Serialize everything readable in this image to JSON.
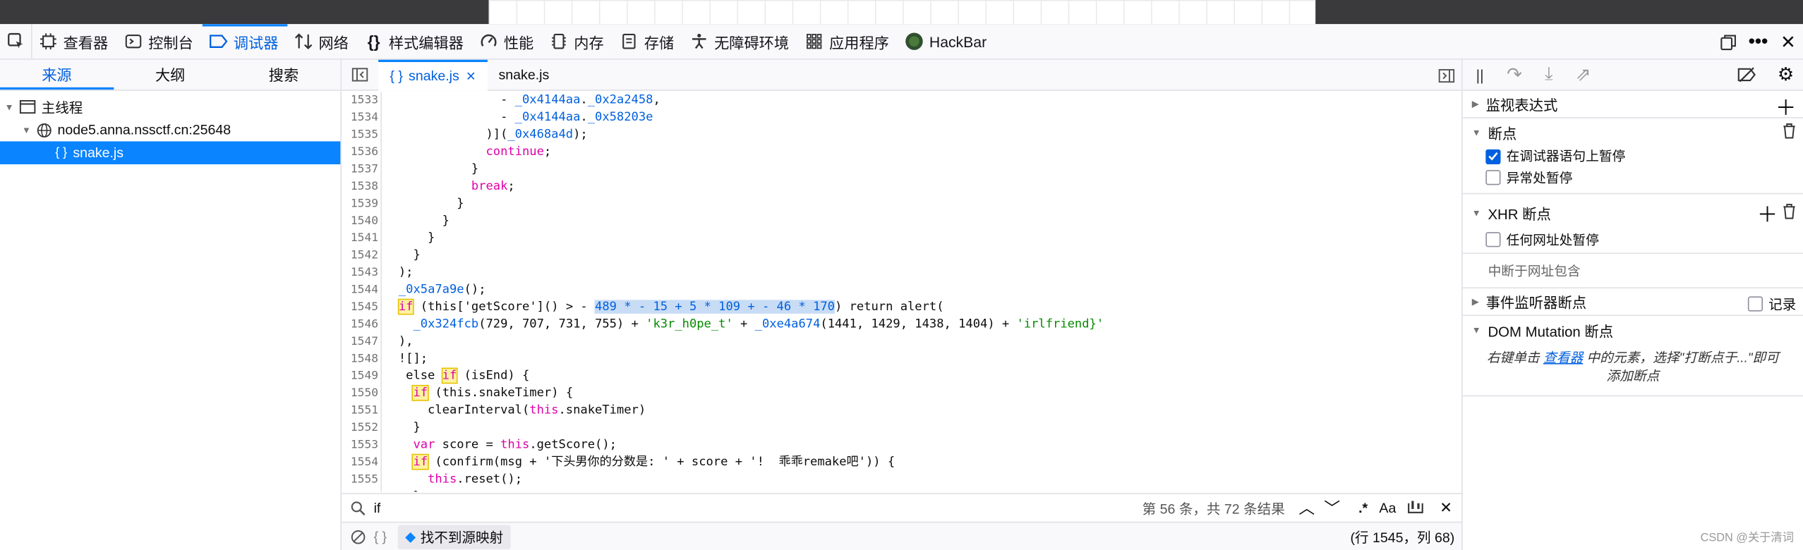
{
  "toolbar": {
    "tabs": [
      "查看器",
      "控制台",
      "调试器",
      "网络",
      "样式编辑器",
      "性能",
      "内存",
      "存储",
      "无障碍环境",
      "应用程序",
      "HackBar"
    ]
  },
  "sources": {
    "tabs": [
      "来源",
      "大纲",
      "搜索"
    ],
    "main_thread": "主线程",
    "domain": "node5.anna.nssctf.cn:25648",
    "file": "snake.js"
  },
  "editor": {
    "tabs": [
      "snake.js",
      "snake.js"
    ],
    "tab_glyph": "{ }",
    "close": "×"
  },
  "code_lines": [
    {
      "n": "1533",
      "t": "                - _0x4144aa._0x2a2458,"
    },
    {
      "n": "1534",
      "t": "                - _0x4144aa._0x58203e"
    },
    {
      "n": "1535",
      "t": "              )](_0x468a4d);"
    },
    {
      "n": "1536",
      "t": "              continue;"
    },
    {
      "n": "1537",
      "t": "            }"
    },
    {
      "n": "1538",
      "t": "            break;"
    },
    {
      "n": "1539",
      "t": "          }"
    },
    {
      "n": "1540",
      "t": "        }"
    },
    {
      "n": "1541",
      "t": "      }"
    },
    {
      "n": "1542",
      "t": "    }"
    },
    {
      "n": "1543",
      "t": "  );"
    },
    {
      "n": "1544",
      "t": "  _0x5a7a9e();"
    },
    {
      "n": "1545",
      "a": "  ",
      "b": "if",
      "c": " (this['getScore']() > - ",
      "d": "489 * - 15 + 5 * 109 + - 46 * 170",
      "e": ") return alert("
    },
    {
      "n": "1546",
      "t": "    _0x324fcb(729, 707, 731, 755) + 'k3r_h0pe_t' + _0xe4a674(1441, 1429, 1438, 1404) + 'irlfriend}'"
    },
    {
      "n": "1547",
      "t": "  ),"
    },
    {
      "n": "1548",
      "t": "  ![];"
    },
    {
      "n": "1549",
      "a": "   else ",
      "b": "if",
      "c": " (isEnd) {"
    },
    {
      "n": "1550",
      "a": "    ",
      "b": "if",
      "c": " (this.snakeTimer) {"
    },
    {
      "n": "1551",
      "t": "      clearInterval(this.snakeTimer)"
    },
    {
      "n": "1552",
      "t": "    }"
    },
    {
      "n": "1553",
      "t": "    var score = this.getScore();"
    },
    {
      "n": "1554",
      "a": "    ",
      "b": "if",
      "c": " (confirm(msg + '下头男你的分数是: ' + score + '!  乖乖remake吧')) {"
    },
    {
      "n": "1555",
      "t": "      this.reset();"
    },
    {
      "n": "1556",
      "t": "    }"
    }
  ],
  "search": {
    "value": "if",
    "result": "第 56 条，共 72 条结果",
    "regex": ".*",
    "case": "Aa"
  },
  "footer": {
    "braces": "{ }",
    "sourcemap": "找不到源映射",
    "position": "(行 1545，列 68)"
  },
  "right": {
    "watch": "监视表达式",
    "breakpoints": "断点",
    "pause_debugger": "在调试器语句上暂停",
    "pause_exceptions": "异常处暂停",
    "xhr": "XHR 断点",
    "any_url": "任何网址处暂停",
    "url_contains": "中断于网址包含",
    "event_listener": "事件监听器断点",
    "log": "记录",
    "dom_mutation": "DOM Mutation 断点",
    "hint_prefix": "右键单击",
    "hint_link": "查看器",
    "hint_suffix": "中的元素，选择\"打断点于...\"即可添加断点"
  },
  "watermark": "CSDN @关于清词"
}
